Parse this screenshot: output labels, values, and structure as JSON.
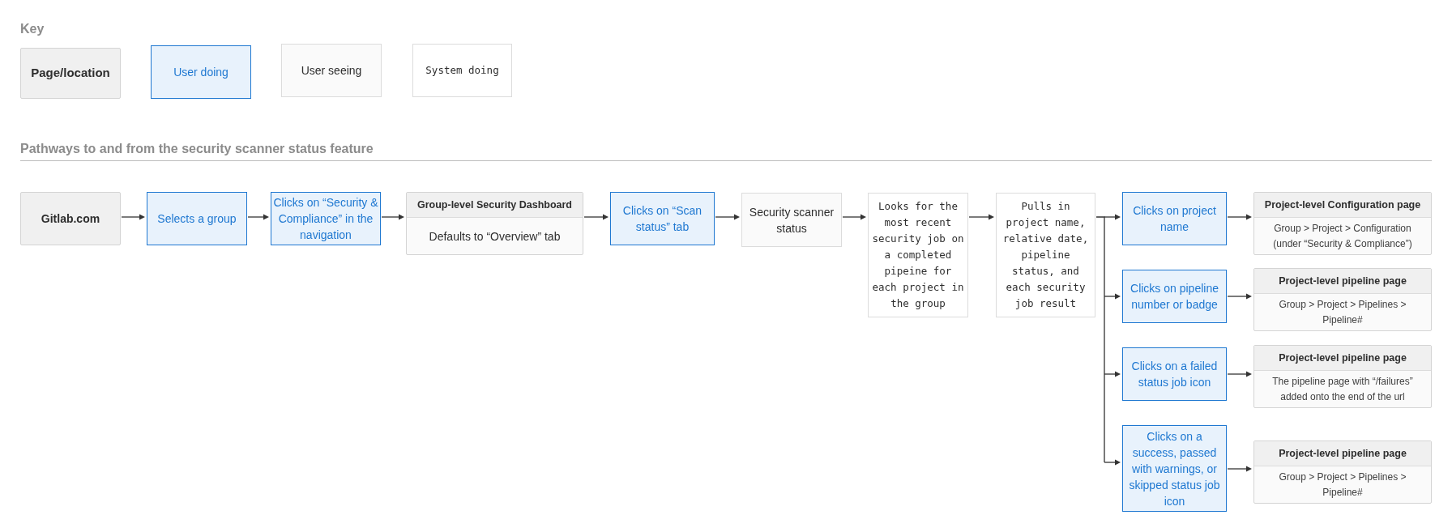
{
  "key": {
    "title": "Key",
    "items": [
      {
        "kind": "page",
        "label": "Page/location"
      },
      {
        "kind": "user_doing",
        "label": "User doing"
      },
      {
        "kind": "user_seeing",
        "label": "User seeing"
      },
      {
        "kind": "system_doing",
        "label": "System doing"
      }
    ]
  },
  "section_title": "Pathways to and from the security scanner status feature",
  "flow": {
    "nodes": [
      {
        "kind": "page",
        "text": "Gitlab.com"
      },
      {
        "kind": "user_doing",
        "text": "Selects a group"
      },
      {
        "kind": "user_doing",
        "text": "Clicks on “Security & Compliance” in the navigation"
      },
      {
        "kind": "page_detail",
        "title": "Group-level Security Dashboard",
        "detail": "Defaults to “Overview” tab"
      },
      {
        "kind": "user_doing",
        "text": "Clicks on “Scan status” tab"
      },
      {
        "kind": "user_seeing",
        "text": "Security scanner status"
      },
      {
        "kind": "system_doing",
        "text": "Looks for the most recent security job on a completed pipeine for each project in the group"
      },
      {
        "kind": "system_doing",
        "text": "Pulls in project name, relative date, pipeline status, and each security job result"
      },
      {
        "kind": "user_doing",
        "text": "Clicks on project name"
      },
      {
        "kind": "page_detail",
        "title": "Project-level Configuration page",
        "detail": "Group > Project > Configuration (under “Security & Compliance”)"
      },
      {
        "kind": "user_doing",
        "text": "Clicks on pipeline number or badge"
      },
      {
        "kind": "page_detail",
        "title": "Project-level pipeline page",
        "detail": "Group > Project > Pipelines > Pipeline#"
      },
      {
        "kind": "user_doing",
        "text": "Clicks on a failed status job icon"
      },
      {
        "kind": "page_detail",
        "title": "Project-level pipeline page",
        "detail": "The pipeline page with “/failures” added onto the end of the url"
      },
      {
        "kind": "user_doing",
        "text": "Clicks on a success, passed with warnings, or skipped status job icon"
      },
      {
        "kind": "page_detail",
        "title": "Project-level pipeline page",
        "detail": "Group > Project > Pipelines > Pipeline#"
      }
    ]
  }
}
